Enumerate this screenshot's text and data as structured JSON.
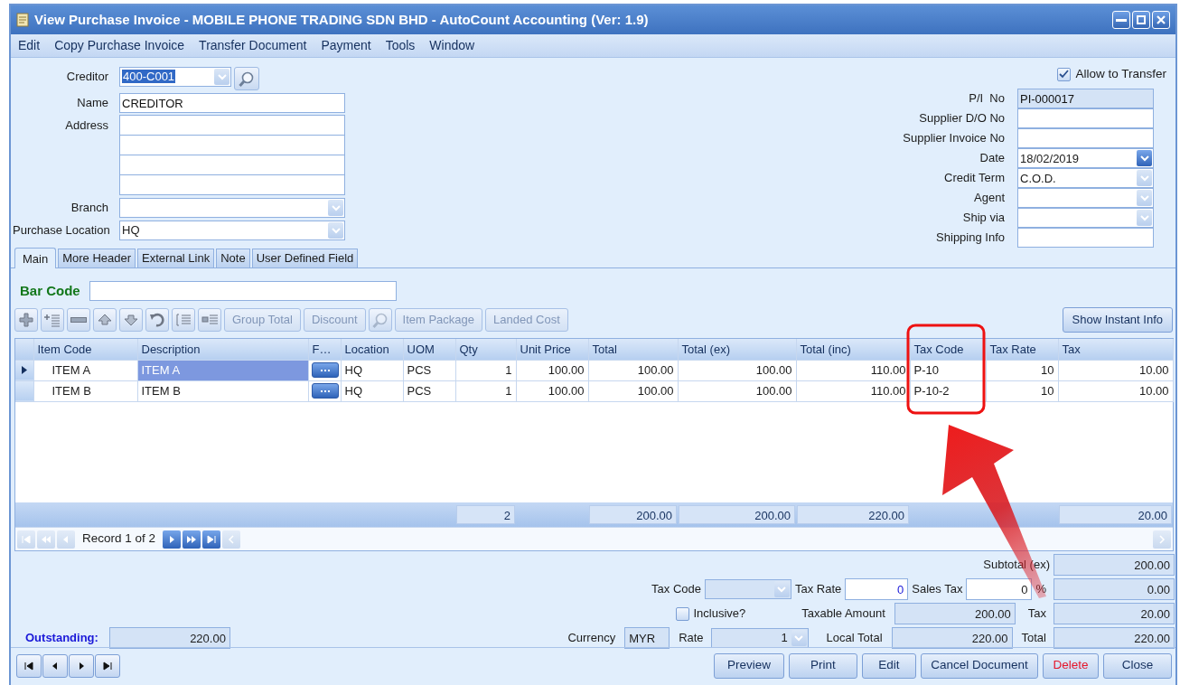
{
  "window": {
    "title": "View Purchase Invoice - MOBILE PHONE TRADING SDN BHD - AutoCount Accounting (Ver: 1.9)"
  },
  "menu": [
    "Edit",
    "Copy Purchase Invoice",
    "Transfer Document",
    "Payment",
    "Tools",
    "Window"
  ],
  "header_left": [
    {
      "label": "Creditor",
      "kind": "lookup",
      "value": "400-C001",
      "highlighted": true,
      "disabled": true
    },
    {
      "label": "Name",
      "kind": "text",
      "value": "CREDITOR",
      "readonly": false
    },
    {
      "label": "Address",
      "kind": "multiline"
    },
    {
      "label": "Branch",
      "kind": "combo",
      "highlighted": false,
      "disabled": true
    },
    {
      "label": "Purchase Location",
      "kind": "combo",
      "value": "HQ",
      "highlighted": false,
      "disabled": true
    }
  ],
  "allow_transfer": {
    "label": "Allow to Transfer",
    "checked": true
  },
  "header_right": [
    {
      "label": "P/I  No",
      "kind": "text",
      "value": "PI-000017",
      "readonly": true
    },
    {
      "label": "Supplier D/O No",
      "kind": "text",
      "readonly": false
    },
    {
      "label": "Supplier Invoice No",
      "kind": "text",
      "readonly": false
    },
    {
      "label": "Date",
      "kind": "combo",
      "value": "18/02/2019",
      "highlighted": false,
      "disabled": false
    },
    {
      "label": "Credit Term",
      "kind": "combo",
      "value": "C.O.D.",
      "highlighted": false,
      "disabled": true
    },
    {
      "label": "Agent",
      "kind": "combo",
      "highlighted": false,
      "disabled": true
    },
    {
      "label": "Ship via",
      "kind": "combo",
      "highlighted": false,
      "disabled": true
    },
    {
      "label": "Shipping Info",
      "kind": "text",
      "readonly": false
    }
  ],
  "tabs": [
    {
      "label": "Main",
      "selected": true
    },
    {
      "label": "More Header",
      "selected": false
    },
    {
      "label": "External Link",
      "selected": false
    },
    {
      "label": "Note",
      "selected": false
    },
    {
      "label": "User Defined Field",
      "selected": false
    }
  ],
  "bar_code": {
    "label": "Bar Code"
  },
  "toolbar": [
    {
      "kind": "add",
      "disabled": false
    },
    {
      "kind": "insert",
      "disabled": false
    },
    {
      "kind": "remove",
      "disabled": false
    },
    {
      "kind": "up",
      "disabled": false
    },
    {
      "kind": "down",
      "disabled": false
    },
    {
      "kind": "undo",
      "disabled": false
    },
    {
      "kind": "outdent",
      "disabled": false
    },
    {
      "kind": "subitem",
      "disabled": false
    },
    {
      "kind": "text",
      "label": "Group Total",
      "disabled": true
    },
    {
      "kind": "text",
      "label": "Discount",
      "disabled": true
    },
    {
      "kind": "search",
      "disabled": true
    },
    {
      "kind": "text",
      "label": "Item Package",
      "disabled": true
    },
    {
      "kind": "text",
      "label": "Landed Cost",
      "disabled": true
    }
  ],
  "instant_info_button": "Show Instant Info",
  "grid": {
    "columns": [
      {
        "label": "Item Code",
        "kind": "code"
      },
      {
        "label": "Description",
        "kind": "text"
      },
      {
        "label": "F…",
        "kind": "button"
      },
      {
        "label": "Location",
        "kind": "text"
      },
      {
        "label": "UOM",
        "kind": "text"
      },
      {
        "label": "Qty",
        "kind": "number",
        "footer": "2"
      },
      {
        "label": "Unit Price",
        "kind": "number"
      },
      {
        "label": "Total",
        "kind": "number",
        "footer": "200.00"
      },
      {
        "label": "Total (ex)",
        "kind": "number",
        "footer": "200.00"
      },
      {
        "label": "Total (inc)",
        "kind": "number",
        "footer": "220.00"
      },
      {
        "label": "Tax Code",
        "kind": "text"
      },
      {
        "label": "Tax Rate",
        "kind": "number"
      },
      {
        "label": "Tax",
        "kind": "number",
        "footer": "20.00"
      }
    ],
    "rows": [
      {
        "selected": true,
        "cells": [
          "ITEM A",
          "ITEM A",
          "",
          "HQ",
          "PCS",
          "1",
          "100.00",
          "100.00",
          "100.00",
          "110.00",
          "P-10",
          "10",
          "10.00"
        ]
      },
      {
        "selected": false,
        "cells": [
          "ITEM B",
          "ITEM B",
          "",
          "HQ",
          "PCS",
          "1",
          "100.00",
          "100.00",
          "100.00",
          "110.00",
          "P-10-2",
          "10",
          "10.00"
        ]
      }
    ]
  },
  "navigator": {
    "text": "Record 1 of 2",
    "buttons": [
      {
        "kind": "first",
        "disabled": true
      },
      {
        "kind": "prev-page",
        "disabled": true
      },
      {
        "kind": "prev",
        "disabled": true
      },
      {
        "kind": "next",
        "disabled": false
      },
      {
        "kind": "next-page",
        "disabled": false
      },
      {
        "kind": "last",
        "disabled": false
      }
    ]
  },
  "totals": {
    "subtotal": {
      "label": "Subtotal (ex)",
      "value": "200.00"
    },
    "tax_code": {
      "label": "Tax Code"
    },
    "tax_rate": {
      "label": "Tax Rate",
      "value": "0"
    },
    "sales_tax": {
      "label": "Sales Tax",
      "value": "0",
      "unit": "%"
    },
    "sales_tax_amount": {
      "value": "0.00"
    },
    "inclusive": {
      "label": "Inclusive?",
      "checked": false
    },
    "taxable_amount": {
      "label": "Taxable Amount",
      "value": "200.00"
    },
    "tax": {
      "label": "Tax",
      "value": "20.00"
    },
    "outstanding": {
      "label": "Outstanding:",
      "value": "220.00"
    },
    "currency": {
      "label": "Currency",
      "value": "MYR"
    },
    "rate": {
      "label": "Rate",
      "value": "1"
    },
    "local_total": {
      "label": "Local Total",
      "value": "220.00"
    },
    "total": {
      "label": "Total",
      "value": "220.00"
    }
  },
  "buttons": [
    {
      "label": "Preview",
      "kind": "normal"
    },
    {
      "label": "Print",
      "kind": "normal"
    },
    {
      "label": "Edit",
      "kind": "normal"
    },
    {
      "label": "Cancel Document",
      "kind": "normal"
    },
    {
      "label": "Delete",
      "kind": "danger"
    },
    {
      "label": "Close",
      "kind": "normal"
    }
  ]
}
